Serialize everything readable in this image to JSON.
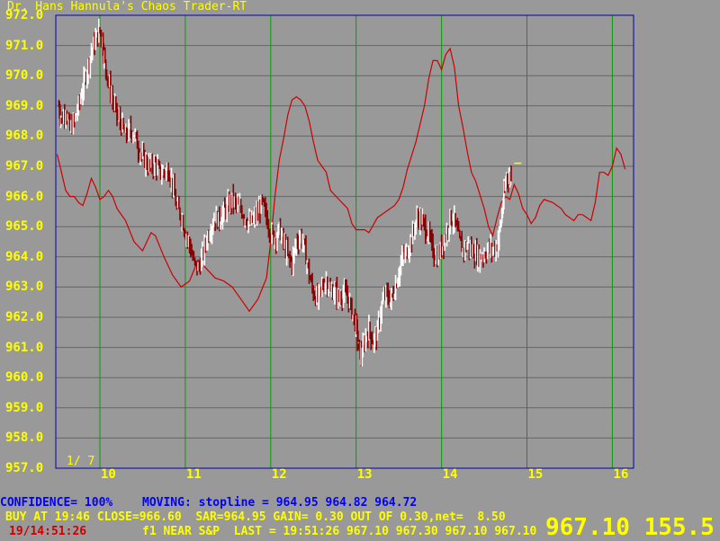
{
  "title": "Dr. Hans Hannula's Chaos Trader-RT",
  "y_axis_labels": [
    "972.0",
    "971.0",
    "970.0",
    "969.0",
    "968.0",
    "967.0",
    "966.0",
    "965.0",
    "964.0",
    "963.0",
    "962.0",
    "961.0",
    "960.0",
    "959.0",
    "958.0",
    "957.0"
  ],
  "x_axis_labels": [
    "10",
    "11",
    "12",
    "13",
    "14",
    "15",
    "16"
  ],
  "page_indicator": "1/ 7",
  "status": {
    "line1_a": "CONFIDENCE= 100%",
    "line1_b": "MOVING: stopline = 964.95 964.82 964.72",
    "line2": "BUY AT 19:46 CLOSE=966.60  SAR=964.95 GAIN= 0.30 OUT OF 0.30,net=  8.50",
    "line3_time": "19/14:51:26",
    "line3_rest": "f1 NEAR S&P  LAST = 19:51:26 967.10 967.30 967.10 967.10",
    "big_price": "967.10 155.5"
  },
  "colors": {
    "background": "#999999",
    "grid_horizontal": "#666666",
    "grid_vertical": "#00a000",
    "frame": "#0000aa",
    "price_bars": "#ffffff",
    "price_bars_down": "#880000",
    "cycle_line": "#cc0000",
    "labels": "#ffff00",
    "status_blue": "#0000ff",
    "status_red": "#cc0000"
  },
  "chart_data": {
    "type": "line",
    "y_range": [
      957.0,
      972.0
    ],
    "x_range": [
      9.5,
      16.2
    ],
    "cycle_forecast": [
      [
        9.5,
        967.4
      ],
      [
        9.55,
        966.8
      ],
      [
        9.6,
        966.2
      ],
      [
        9.65,
        966.0
      ],
      [
        9.7,
        966.0
      ],
      [
        9.75,
        965.8
      ],
      [
        9.8,
        965.7
      ],
      [
        9.85,
        966.1
      ],
      [
        9.9,
        966.6
      ],
      [
        9.95,
        966.3
      ],
      [
        10.0,
        965.9
      ],
      [
        10.05,
        966.0
      ],
      [
        10.1,
        966.2
      ],
      [
        10.15,
        966.0
      ],
      [
        10.2,
        965.6
      ],
      [
        10.3,
        965.2
      ],
      [
        10.4,
        964.5
      ],
      [
        10.5,
        964.2
      ],
      [
        10.6,
        964.8
      ],
      [
        10.65,
        964.7
      ],
      [
        10.75,
        964.0
      ],
      [
        10.85,
        963.4
      ],
      [
        10.95,
        963.0
      ],
      [
        11.05,
        963.2
      ],
      [
        11.15,
        963.9
      ],
      [
        11.25,
        963.6
      ],
      [
        11.35,
        963.3
      ],
      [
        11.45,
        963.2
      ],
      [
        11.55,
        963.0
      ],
      [
        11.65,
        962.6
      ],
      [
        11.75,
        962.2
      ],
      [
        11.85,
        962.6
      ],
      [
        11.95,
        963.3
      ],
      [
        12.0,
        964.5
      ],
      [
        12.05,
        966.0
      ],
      [
        12.1,
        967.2
      ],
      [
        12.15,
        967.9
      ],
      [
        12.2,
        968.7
      ],
      [
        12.25,
        969.2
      ],
      [
        12.3,
        969.3
      ],
      [
        12.35,
        969.2
      ],
      [
        12.4,
        969.0
      ],
      [
        12.45,
        968.5
      ],
      [
        12.5,
        967.8
      ],
      [
        12.55,
        967.2
      ],
      [
        12.6,
        967.0
      ],
      [
        12.65,
        966.8
      ],
      [
        12.7,
        966.2
      ],
      [
        12.8,
        965.9
      ],
      [
        12.9,
        965.6
      ],
      [
        12.95,
        965.1
      ],
      [
        13.0,
        964.9
      ],
      [
        13.1,
        964.9
      ],
      [
        13.15,
        964.8
      ],
      [
        13.25,
        965.3
      ],
      [
        13.35,
        965.5
      ],
      [
        13.45,
        965.7
      ],
      [
        13.5,
        965.9
      ],
      [
        13.55,
        966.3
      ],
      [
        13.6,
        966.9
      ],
      [
        13.7,
        967.8
      ],
      [
        13.8,
        969.0
      ],
      [
        13.85,
        969.9
      ],
      [
        13.9,
        970.5
      ],
      [
        13.95,
        970.5
      ],
      [
        14.0,
        970.2
      ],
      [
        14.05,
        970.7
      ],
      [
        14.1,
        970.9
      ],
      [
        14.15,
        970.3
      ],
      [
        14.2,
        969.0
      ],
      [
        14.25,
        968.3
      ],
      [
        14.3,
        967.5
      ],
      [
        14.35,
        966.8
      ],
      [
        14.4,
        966.5
      ],
      [
        14.5,
        965.6
      ],
      [
        14.55,
        965.0
      ],
      [
        14.6,
        964.7
      ],
      [
        14.65,
        965.3
      ],
      [
        14.7,
        965.8
      ],
      [
        14.75,
        966.0
      ],
      [
        14.8,
        965.9
      ],
      [
        14.85,
        966.4
      ],
      [
        14.9,
        966.1
      ],
      [
        14.95,
        965.6
      ],
      [
        15.0,
        965.4
      ],
      [
        15.05,
        965.1
      ],
      [
        15.1,
        965.3
      ],
      [
        15.15,
        965.7
      ],
      [
        15.2,
        965.9
      ],
      [
        15.3,
        965.8
      ],
      [
        15.4,
        965.6
      ],
      [
        15.45,
        965.4
      ],
      [
        15.55,
        965.2
      ],
      [
        15.6,
        965.4
      ],
      [
        15.65,
        965.4
      ],
      [
        15.7,
        965.3
      ],
      [
        15.75,
        965.2
      ],
      [
        15.8,
        965.8
      ],
      [
        15.85,
        966.8
      ],
      [
        15.9,
        966.8
      ],
      [
        15.95,
        966.7
      ],
      [
        16.0,
        967.0
      ],
      [
        16.05,
        967.6
      ],
      [
        16.1,
        967.4
      ],
      [
        16.15,
        966.9
      ]
    ],
    "price_path": [
      [
        9.52,
        969.0
      ],
      [
        9.55,
        968.5
      ],
      [
        9.6,
        968.9
      ],
      [
        9.65,
        968.2
      ],
      [
        9.7,
        968.5
      ],
      [
        9.75,
        969.0
      ],
      [
        9.8,
        969.6
      ],
      [
        9.85,
        970.2
      ],
      [
        9.9,
        970.8
      ],
      [
        9.95,
        971.2
      ],
      [
        10.0,
        971.5
      ],
      [
        10.03,
        971.2
      ],
      [
        10.06,
        970.4
      ],
      [
        10.1,
        969.8
      ],
      [
        10.15,
        969.2
      ],
      [
        10.2,
        968.7
      ],
      [
        10.25,
        968.4
      ],
      [
        10.3,
        968.0
      ],
      [
        10.35,
        968.2
      ],
      [
        10.4,
        968.1
      ],
      [
        10.45,
        967.6
      ],
      [
        10.5,
        967.3
      ],
      [
        10.55,
        967.1
      ],
      [
        10.6,
        967.0
      ],
      [
        10.65,
        967.1
      ],
      [
        10.7,
        966.8
      ],
      [
        10.75,
        966.8
      ],
      [
        10.8,
        966.9
      ],
      [
        10.85,
        966.4
      ],
      [
        10.9,
        965.6
      ],
      [
        10.95,
        965.4
      ],
      [
        11.0,
        964.8
      ],
      [
        11.05,
        964.4
      ],
      [
        11.1,
        963.8
      ],
      [
        11.15,
        963.6
      ],
      [
        11.2,
        964.0
      ],
      [
        11.25,
        964.6
      ],
      [
        11.3,
        965.0
      ],
      [
        11.35,
        965.3
      ],
      [
        11.4,
        965.2
      ],
      [
        11.45,
        965.5
      ],
      [
        11.5,
        965.7
      ],
      [
        11.55,
        965.9
      ],
      [
        11.6,
        965.7
      ],
      [
        11.65,
        965.6
      ],
      [
        11.7,
        965.3
      ],
      [
        11.75,
        965.1
      ],
      [
        11.8,
        965.2
      ],
      [
        11.85,
        965.5
      ],
      [
        11.9,
        965.8
      ],
      [
        11.95,
        965.3
      ],
      [
        12.0,
        964.8
      ],
      [
        12.05,
        964.6
      ],
      [
        12.1,
        964.9
      ],
      [
        12.15,
        964.5
      ],
      [
        12.2,
        964.0
      ],
      [
        12.25,
        963.8
      ],
      [
        12.3,
        964.5
      ],
      [
        12.35,
        964.7
      ],
      [
        12.4,
        964.2
      ],
      [
        12.45,
        963.4
      ],
      [
        12.5,
        962.8
      ],
      [
        12.55,
        962.6
      ],
      [
        12.6,
        963.0
      ],
      [
        12.65,
        963.2
      ],
      [
        12.7,
        962.8
      ],
      [
        12.75,
        962.9
      ],
      [
        12.8,
        962.6
      ],
      [
        12.85,
        962.8
      ],
      [
        12.9,
        962.7
      ],
      [
        12.95,
        962.2
      ],
      [
        13.0,
        961.7
      ],
      [
        13.03,
        961.0
      ],
      [
        13.06,
        960.7
      ],
      [
        13.1,
        961.2
      ],
      [
        13.15,
        961.6
      ],
      [
        13.2,
        961.2
      ],
      [
        13.25,
        961.5
      ],
      [
        13.3,
        962.4
      ],
      [
        13.35,
        962.8
      ],
      [
        13.4,
        962.5
      ],
      [
        13.45,
        962.9
      ],
      [
        13.5,
        963.5
      ],
      [
        13.55,
        964.0
      ],
      [
        13.6,
        964.2
      ],
      [
        13.65,
        964.6
      ],
      [
        13.7,
        965.2
      ],
      [
        13.75,
        965.3
      ],
      [
        13.8,
        965.0
      ],
      [
        13.85,
        964.7
      ],
      [
        13.9,
        964.2
      ],
      [
        13.95,
        964.0
      ],
      [
        14.0,
        964.3
      ],
      [
        14.05,
        964.7
      ],
      [
        14.1,
        965.3
      ],
      [
        14.15,
        965.2
      ],
      [
        14.2,
        964.6
      ],
      [
        14.25,
        964.2
      ],
      [
        14.3,
        964.4
      ],
      [
        14.35,
        964.2
      ],
      [
        14.4,
        964.1
      ],
      [
        14.45,
        964.0
      ],
      [
        14.5,
        964.1
      ],
      [
        14.55,
        964.3
      ],
      [
        14.6,
        964.2
      ],
      [
        14.65,
        964.4
      ],
      [
        14.7,
        965.2
      ],
      [
        14.73,
        966.0
      ],
      [
        14.76,
        966.7
      ],
      [
        14.8,
        966.6
      ],
      [
        14.82,
        966.9
      ]
    ],
    "last_tick": [
      14.85,
      967.1
    ]
  }
}
